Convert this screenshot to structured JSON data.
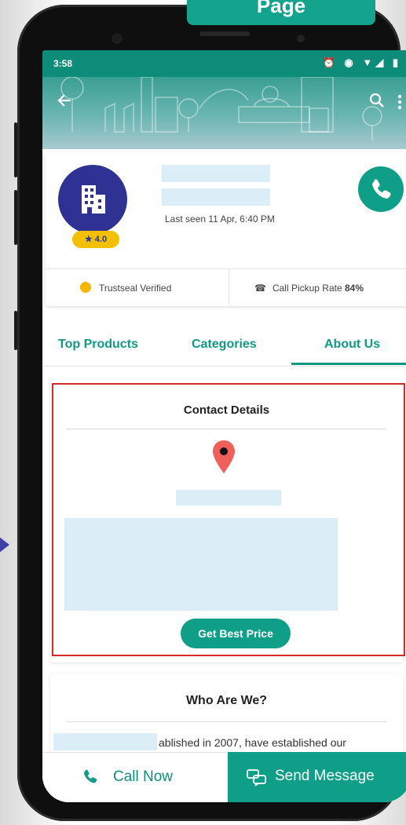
{
  "page_tag": "Page",
  "status_bar": {
    "time": "3:58",
    "icons": "⏰ ◉ ▼◢ ▮"
  },
  "header": {
    "back_icon": "arrow-left-icon",
    "search_icon": "search-icon",
    "more_icon": "more-vert-icon"
  },
  "profile": {
    "rating": "★ 4.0",
    "last_seen": "Last seen 11 Apr, 6:40 PM",
    "trustseal": "Trustseal Verified",
    "pickup_rate_label": "Call Pickup Rate ",
    "pickup_rate_value": "84%"
  },
  "tabs": [
    {
      "label": "Top Products"
    },
    {
      "label": "Categories"
    },
    {
      "label": "About Us",
      "active": true
    }
  ],
  "contact": {
    "title": "Contact Details",
    "cta": "Get Best Price"
  },
  "who": {
    "title": "Who Are We?",
    "text": "ablished in 2007, have established our"
  },
  "bottom": {
    "call_label": "Call Now",
    "message_label": "Send Message"
  },
  "colors": {
    "accent": "#0f9f88",
    "brand": "#2f3293",
    "highlight": "#d42a2a"
  }
}
